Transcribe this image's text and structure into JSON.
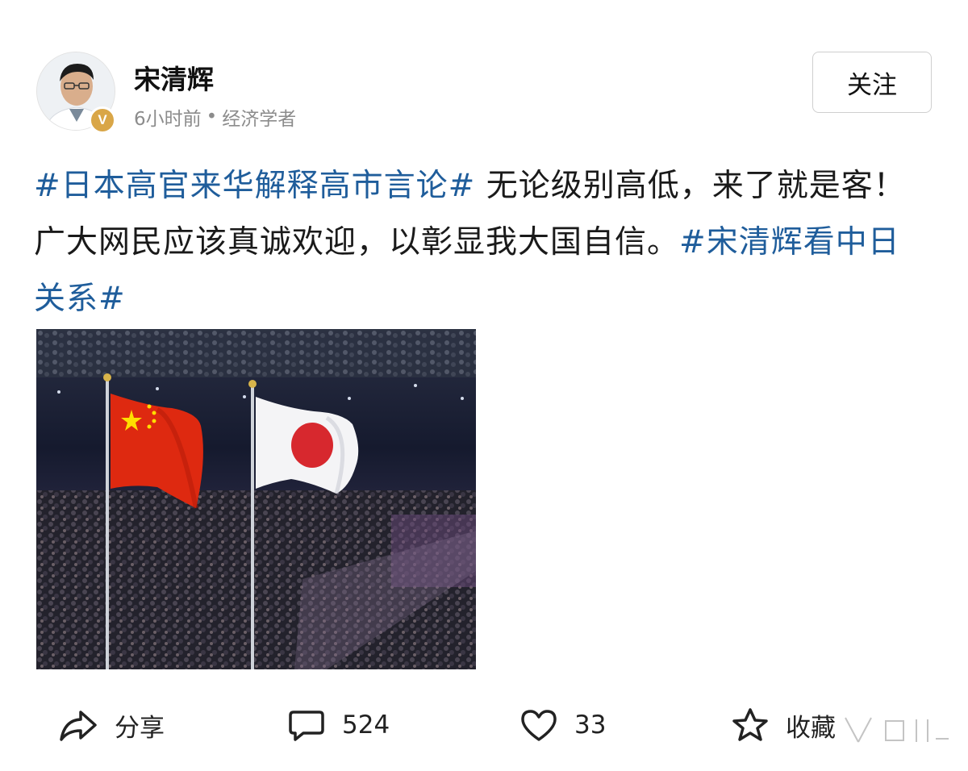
{
  "author": {
    "name": "宋清辉",
    "time": "6小时前",
    "separator": "•",
    "title": "经济学者",
    "verified_badge": "V",
    "badge_color": "#d9a647"
  },
  "follow_label": "关注",
  "post": {
    "hashtag_1": "#日本高官来华解释高市言论#",
    "text_body": " 无论级别高低，来了就是客！广大网民应该真诚欢迎，以彰显我大国自信。",
    "hashtag_2": "#宋清辉看中日关系#",
    "hashtag_color": "#1f5d9b"
  },
  "image": {
    "description_icon": "flags-photo"
  },
  "actions": {
    "share_label": "分享",
    "comment_count": "524",
    "like_count": "33",
    "favorite_label": "收藏"
  }
}
